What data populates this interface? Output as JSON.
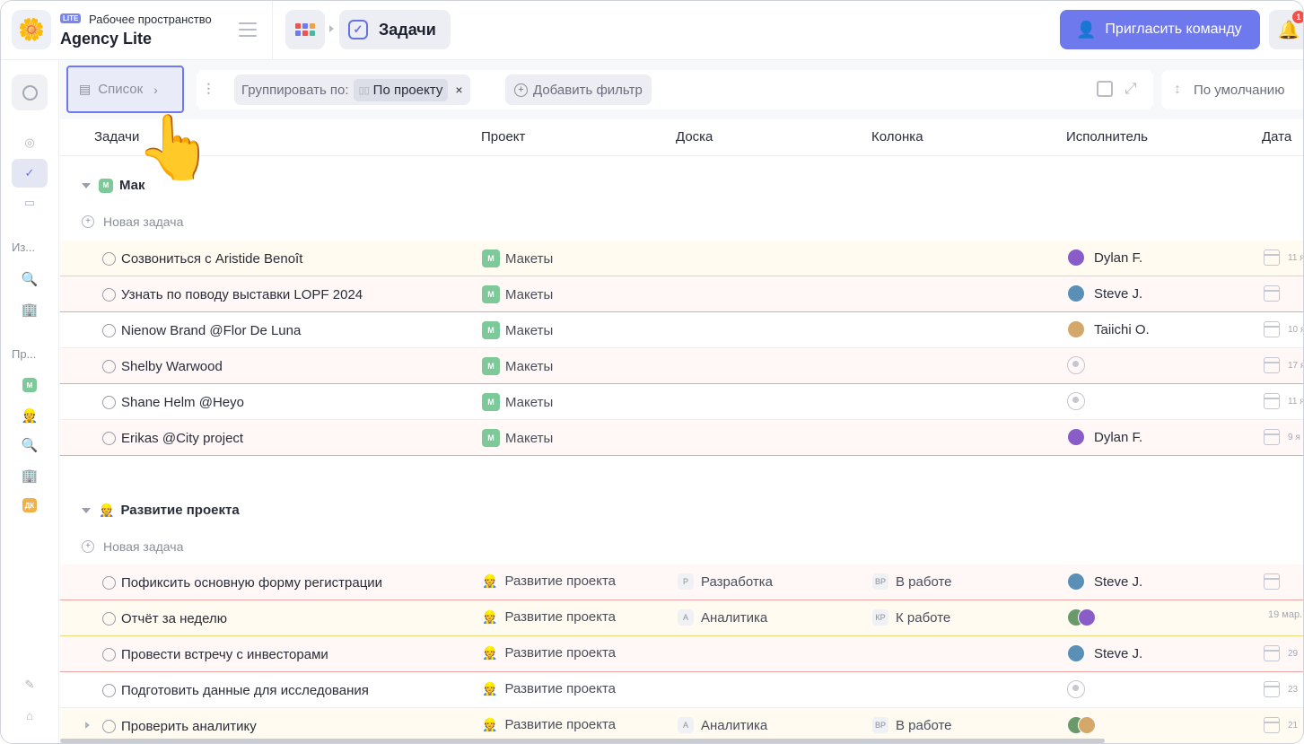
{
  "workspace": {
    "badge": "LITE",
    "label": "Рабочее пространство",
    "name": "Agency Lite"
  },
  "header": {
    "current_page": "Задачи",
    "invite_label": "Пригласить команду",
    "notifications_count": "1"
  },
  "rail": {
    "section1": "Из...",
    "section2": "Пр...",
    "project_letter": "М",
    "project_letter2": "ДК"
  },
  "toolbar": {
    "view_label": "Список",
    "group_by_label": "Группировать по:",
    "group_by_value": "По проекту",
    "add_filter_label": "Добавить фильтр",
    "sort_label": "По умолчанию"
  },
  "columns": {
    "tasks": "Задачи",
    "project": "Проект",
    "board": "Доска",
    "column": "Колонка",
    "assignee": "Исполнитель",
    "date": "Дата"
  },
  "new_task_label": "Новая задача",
  "groups": [
    {
      "title": "Мак",
      "letter": "М",
      "tasks": [
        {
          "name": "Созвониться с Aristide Benoît",
          "project": "Макеты",
          "assignee": "Dylan F.",
          "date": "11 я"
        },
        {
          "name": "Узнать по поводу выставки LOPF 2024",
          "project": "Макеты",
          "assignee": "Steve J.",
          "date": ""
        },
        {
          "name": "Nienow Brand @Flor De Luna",
          "project": "Макеты",
          "assignee": "Taiichi O.",
          "date": "10 я"
        },
        {
          "name": "Shelby Warwood",
          "project": "Макеты",
          "assignee": "",
          "date": "17 я"
        },
        {
          "name": "Shane Helm @Heyo",
          "project": "Макеты",
          "assignee": "",
          "date": "11 я"
        },
        {
          "name": "Erikas @City project",
          "project": "Макеты",
          "assignee": "Dylan F.",
          "date": "9 я"
        }
      ]
    },
    {
      "title": "Развитие проекта",
      "tasks": [
        {
          "name": "Пофиксить основную форму регистрации",
          "project": "Развитие проекта",
          "board_tag": "Р",
          "board": "Разработка",
          "column_tag": "ВР",
          "column": "В работе",
          "assignee": "Steve J.",
          "date": ""
        },
        {
          "name": "Отчёт за неделю",
          "project": "Развитие проекта",
          "board_tag": "А",
          "board": "Аналитика",
          "column_tag": "КР",
          "column": "К работе",
          "assignee": "",
          "date": "19 мар."
        },
        {
          "name": "Провести встречу с инвесторами",
          "project": "Развитие проекта",
          "assignee": "Steve J.",
          "date": "29"
        },
        {
          "name": "Подготовить данные для исследования",
          "project": "Развитие проекта",
          "assignee": "",
          "date": "23"
        },
        {
          "name": "Проверить аналитику",
          "project": "Развитие проекта",
          "board_tag": "А",
          "board": "Аналитика",
          "column_tag": "ВР",
          "column": "В работе",
          "assignee": "",
          "date": "21"
        }
      ]
    }
  ],
  "colors": {
    "accent": "#6f79ee",
    "project_green": "#7dc99a",
    "row_yellow": "#fffbf0",
    "row_pink": "#fff8f7"
  }
}
